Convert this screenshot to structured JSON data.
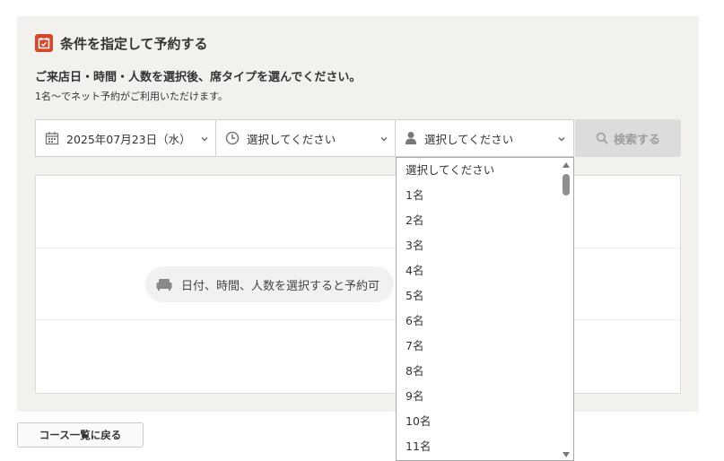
{
  "header": {
    "title": "条件を指定して予約する",
    "icon": "calendar-icon"
  },
  "subtitle": "ご来店日・時間・人数を選択後、席タイプを選んでください。",
  "note": "1名～でネット予約がご利用いただけます。",
  "search": {
    "date_value": "2025年07月23日（水）",
    "time_value": "選択してください",
    "people_value": "選択してください",
    "button_label": "検索する"
  },
  "results": {
    "message": "日付、時間、人数を選択すると予約可"
  },
  "back_button": "コース一覧に戻る",
  "dropdown": {
    "options": [
      "選択してください",
      "1名",
      "2名",
      "3名",
      "4名",
      "5名",
      "6名",
      "7名",
      "8名",
      "9名",
      "10名",
      "11名"
    ]
  },
  "colors": {
    "accent": "#d9472b",
    "panel_bg": "#f2f1ee",
    "button_disabled": "#dcdcdc"
  }
}
